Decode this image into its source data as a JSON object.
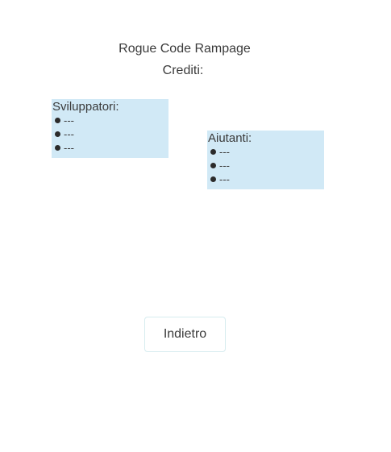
{
  "title": "Rogue Code Rampage",
  "subtitle": "Crediti:",
  "developers": {
    "heading": "Sviluppatori:",
    "items": [
      "---",
      "---",
      "---"
    ]
  },
  "helpers": {
    "heading": "Aiutanti:",
    "items": [
      "---",
      "---",
      "---"
    ]
  },
  "back_button": {
    "label": "Indietro"
  },
  "colors": {
    "panel_background": "#d1e9f6",
    "button_border": "#d6ecef",
    "text": "#3a3a3a"
  }
}
